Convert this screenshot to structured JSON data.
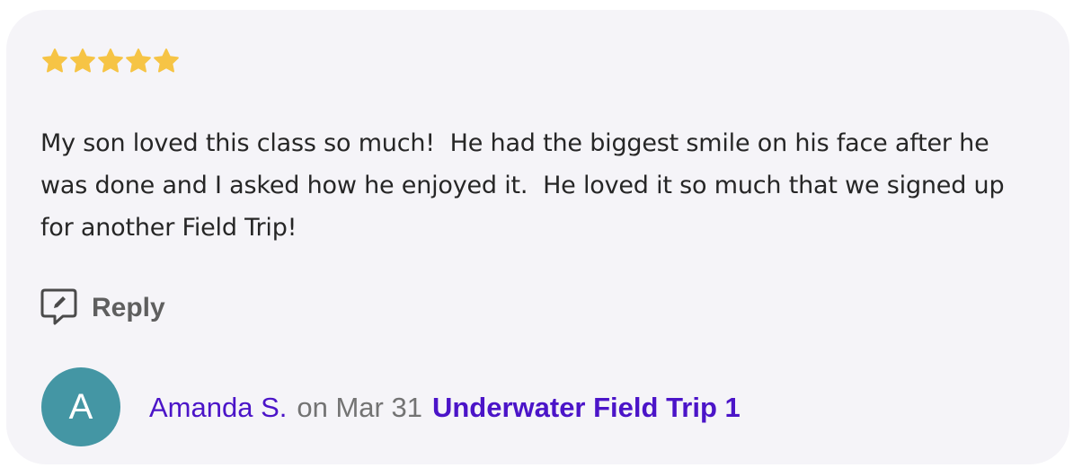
{
  "review": {
    "rating": 5,
    "max_rating": 5,
    "star_color": "#f6c445",
    "text": "My son loved this class so much!  He had the biggest smile on his face after he was done and I asked how he enjoyed it.  He loved it so much that we signed up for another Field Trip!"
  },
  "reply": {
    "icon": "reply-edit-icon",
    "label": "Reply"
  },
  "reviewer": {
    "avatar_initial": "A",
    "avatar_color": "#4496a4",
    "name": "Amanda S.",
    "date_text": "on Mar 31",
    "class_title": "Underwater Field Trip 1",
    "link_color": "#4b14c8"
  }
}
